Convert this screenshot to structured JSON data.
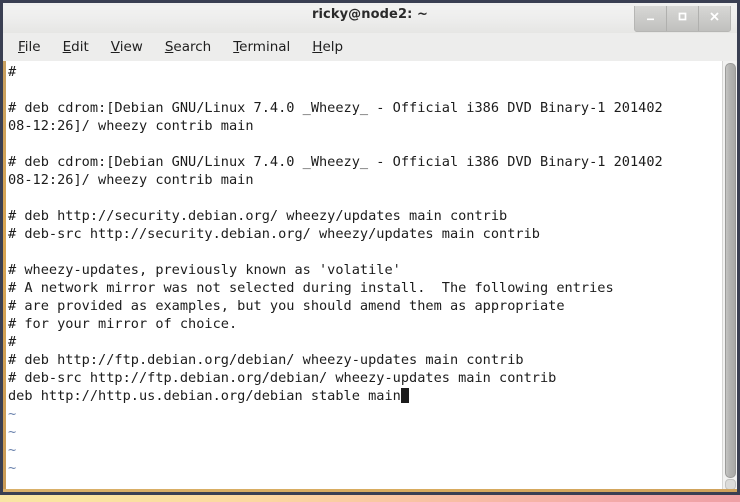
{
  "window": {
    "title": "ricky@node2: ~",
    "controls": [
      {
        "name": "minimize",
        "glyph": "_"
      },
      {
        "name": "maximize",
        "glyph": "□"
      },
      {
        "name": "close",
        "glyph": "×"
      }
    ]
  },
  "menubar": {
    "items": [
      {
        "mnemonic": "F",
        "rest": "ile"
      },
      {
        "mnemonic": "E",
        "rest": "dit"
      },
      {
        "mnemonic": "V",
        "rest": "iew"
      },
      {
        "mnemonic": "S",
        "rest": "earch"
      },
      {
        "mnemonic": "T",
        "rest": "erminal"
      },
      {
        "mnemonic": "H",
        "rest": "elp"
      }
    ]
  },
  "terminal": {
    "lines": [
      {
        "text": "#",
        "kind": "text"
      },
      {
        "text": "",
        "kind": "blank"
      },
      {
        "text": "# deb cdrom:[Debian GNU/Linux 7.4.0 _Wheezy_ - Official i386 DVD Binary-1 201402",
        "kind": "text"
      },
      {
        "text": "08-12:26]/ wheezy contrib main",
        "kind": "text"
      },
      {
        "text": "",
        "kind": "blank"
      },
      {
        "text": "# deb cdrom:[Debian GNU/Linux 7.4.0 _Wheezy_ - Official i386 DVD Binary-1 201402",
        "kind": "text"
      },
      {
        "text": "08-12:26]/ wheezy contrib main",
        "kind": "text"
      },
      {
        "text": "",
        "kind": "blank"
      },
      {
        "text": "# deb http://security.debian.org/ wheezy/updates main contrib",
        "kind": "text"
      },
      {
        "text": "# deb-src http://security.debian.org/ wheezy/updates main contrib",
        "kind": "text"
      },
      {
        "text": "",
        "kind": "blank"
      },
      {
        "text": "# wheezy-updates, previously known as 'volatile'",
        "kind": "text"
      },
      {
        "text": "# A network mirror was not selected during install.  The following entries",
        "kind": "text"
      },
      {
        "text": "# are provided as examples, but you should amend them as appropriate",
        "kind": "text"
      },
      {
        "text": "# for your mirror of choice.",
        "kind": "text"
      },
      {
        "text": "#",
        "kind": "text"
      },
      {
        "text": "# deb http://ftp.debian.org/debian/ wheezy-updates main contrib",
        "kind": "text"
      },
      {
        "text": "# deb-src http://ftp.debian.org/debian/ wheezy-updates main contrib",
        "kind": "text"
      },
      {
        "text": "deb http://http.us.debian.org/debian stable main",
        "kind": "cursor-line"
      },
      {
        "text": "~",
        "kind": "tilde"
      },
      {
        "text": "~",
        "kind": "tilde"
      },
      {
        "text": "~",
        "kind": "tilde"
      },
      {
        "text": "~",
        "kind": "tilde"
      }
    ],
    "cursor_after_text": true,
    "colors": {
      "background": "#ffffff",
      "foreground": "#1c1c1c",
      "tilde": "#6a82ad",
      "cursor": "#1c1c1c"
    }
  },
  "scrollbar": {
    "orientation": "vertical",
    "thumb_position": "full"
  },
  "desktop": {
    "background_left": "#f6e6a8",
    "background_right": "#efa0a6"
  }
}
